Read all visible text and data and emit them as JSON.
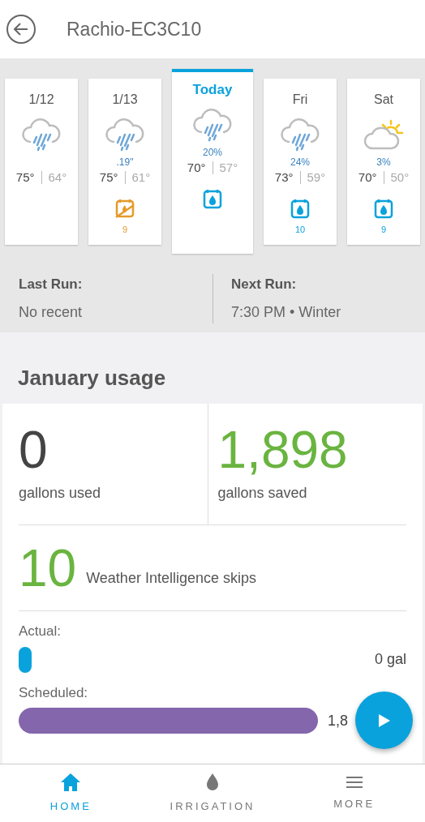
{
  "header": {
    "title": "Rachio-EC3C10"
  },
  "days": [
    {
      "label": "1/12",
      "selected": false,
      "forecast": {
        "kind": "rain"
      },
      "high": "75°",
      "low": "64°"
    },
    {
      "label": "1/13",
      "selected": false,
      "forecast": {
        "kind": "rain",
        "precip": ".19\""
      },
      "high": "75°",
      "low": "61°",
      "watering": {
        "kind": "skip",
        "count": "9"
      }
    },
    {
      "label": "Today",
      "selected": true,
      "forecast": {
        "kind": "rain",
        "precip": "20%"
      },
      "high": "70°",
      "low": "57°",
      "watering": {
        "kind": "water"
      }
    },
    {
      "label": "Fri",
      "selected": false,
      "forecast": {
        "kind": "rain",
        "precip": "24%"
      },
      "high": "73°",
      "low": "59°",
      "watering": {
        "kind": "water",
        "count": "10"
      }
    },
    {
      "label": "Sat",
      "selected": false,
      "forecast": {
        "kind": "partly-sunny",
        "precip": "3%"
      },
      "high": "70°",
      "low": "50°",
      "watering": {
        "kind": "water",
        "count": "9"
      }
    }
  ],
  "runs": [
    {
      "label": "Last Run:",
      "value": "No recent"
    },
    {
      "label": "Next Run:",
      "value": "7:30 PM • Winter"
    }
  ],
  "usage": {
    "title": "January usage",
    "used": {
      "value": "0",
      "label": "gallons used"
    },
    "saved": {
      "value": "1,898",
      "label": "gallons saved"
    },
    "skips": {
      "value": "10",
      "label": "Weather Intelligence skips"
    },
    "bars": [
      {
        "label": "Actual:",
        "kind": "empty",
        "color": "#0aa2dc",
        "reading": "0 gal"
      },
      {
        "label": "Scheduled:",
        "kind": "full",
        "color": "#8466ac",
        "reading": "1,8"
      }
    ]
  },
  "nav": [
    {
      "label": "HOME",
      "selected": true,
      "kind": "home"
    },
    {
      "label": "IRRIGATION",
      "selected": false,
      "kind": "drop"
    },
    {
      "label": "MORE",
      "selected": false,
      "kind": "menu"
    }
  ]
}
